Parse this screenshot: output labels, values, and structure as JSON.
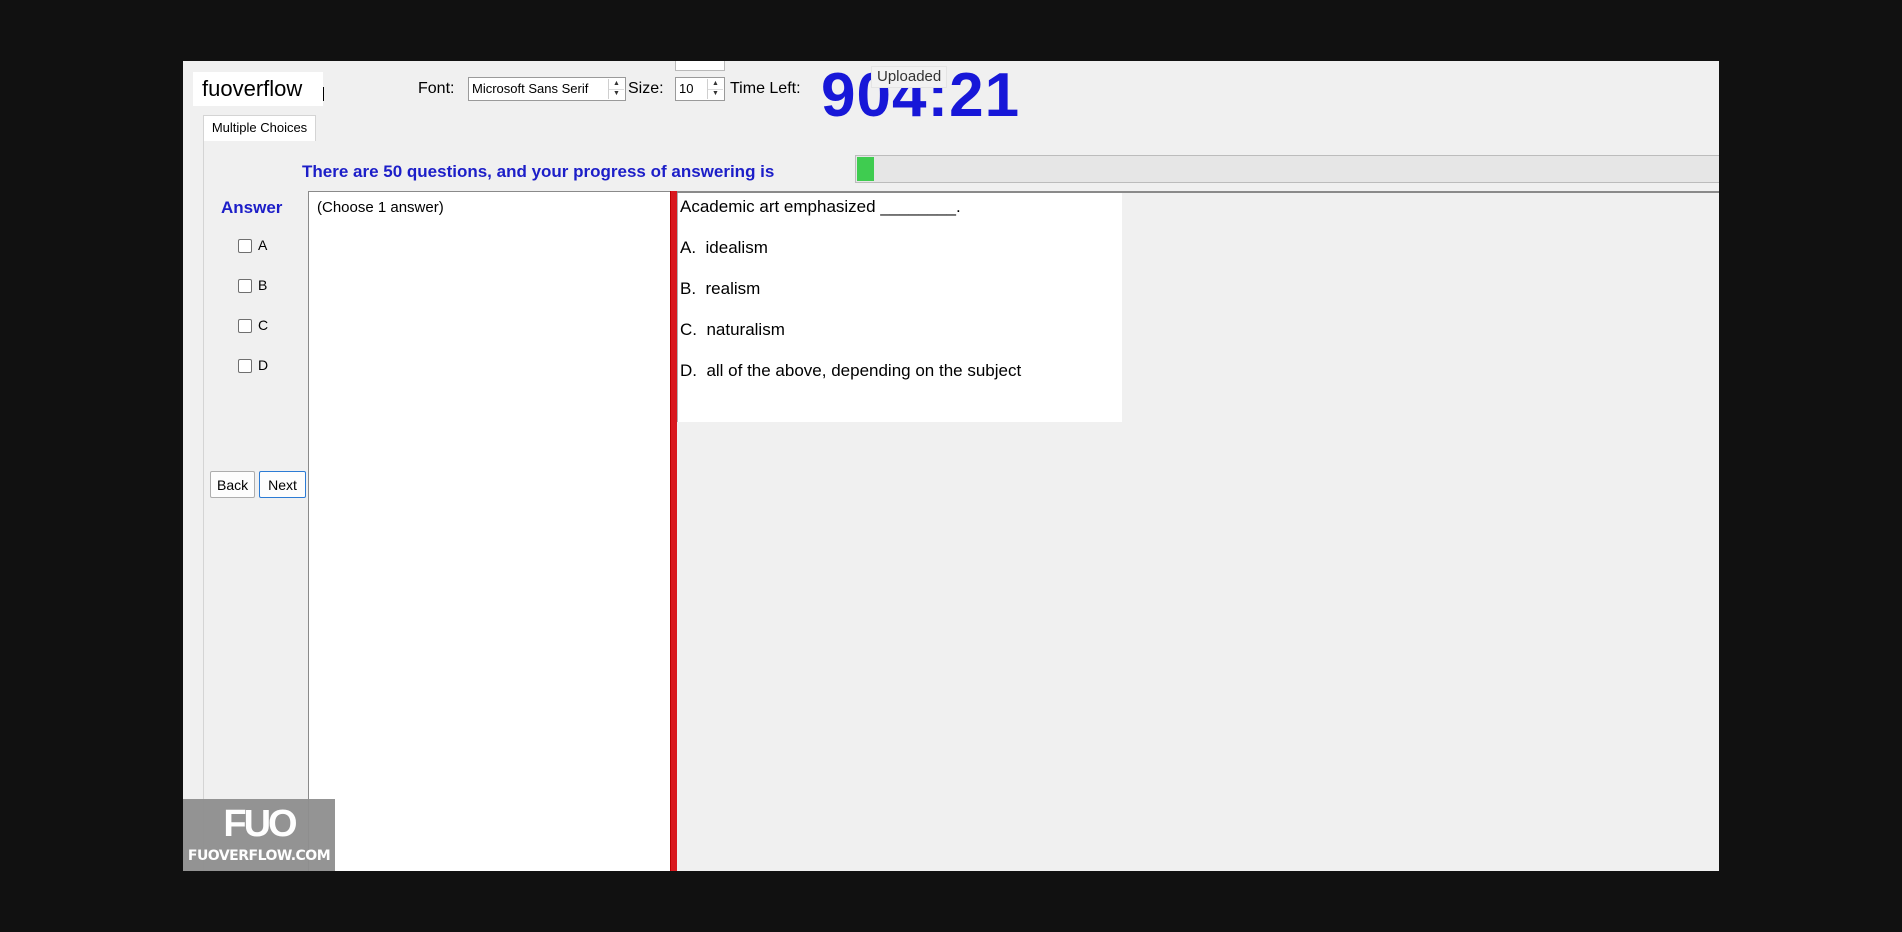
{
  "header": {
    "brand": "fuoverflow",
    "font_label": "Font:",
    "font_value": "Microsoft Sans Serif",
    "size_label": "Size:",
    "size_value": "10",
    "time_left_label": "Time Left:",
    "timer_value": "904:21",
    "upload_status": "Uploaded"
  },
  "tabs": [
    {
      "label": "Multiple Choices",
      "active": true
    }
  ],
  "progress": {
    "text": "There are 50 questions, and your progress of answering is",
    "fraction": 0.02,
    "fill_color": "#3fcc50"
  },
  "answer": {
    "title": "Answer",
    "options": [
      "A",
      "B",
      "C",
      "D"
    ]
  },
  "nav": {
    "back_label": "Back",
    "next_label": "Next"
  },
  "left_pane": {
    "instruction": "(Choose 1 answer)"
  },
  "question": {
    "stem": "Academic art emphasized ________.",
    "choices": [
      "A.  idealism",
      "B.  realism",
      "C.  naturalism",
      "D.  all of the above, depending on the subject"
    ]
  },
  "watermark": {
    "logo": "FUO",
    "site": "FUOVERFLOW.COM"
  },
  "colors": {
    "accent_text": "#1c1ec8",
    "timer": "#1717d8",
    "divider": "#d9181e"
  }
}
